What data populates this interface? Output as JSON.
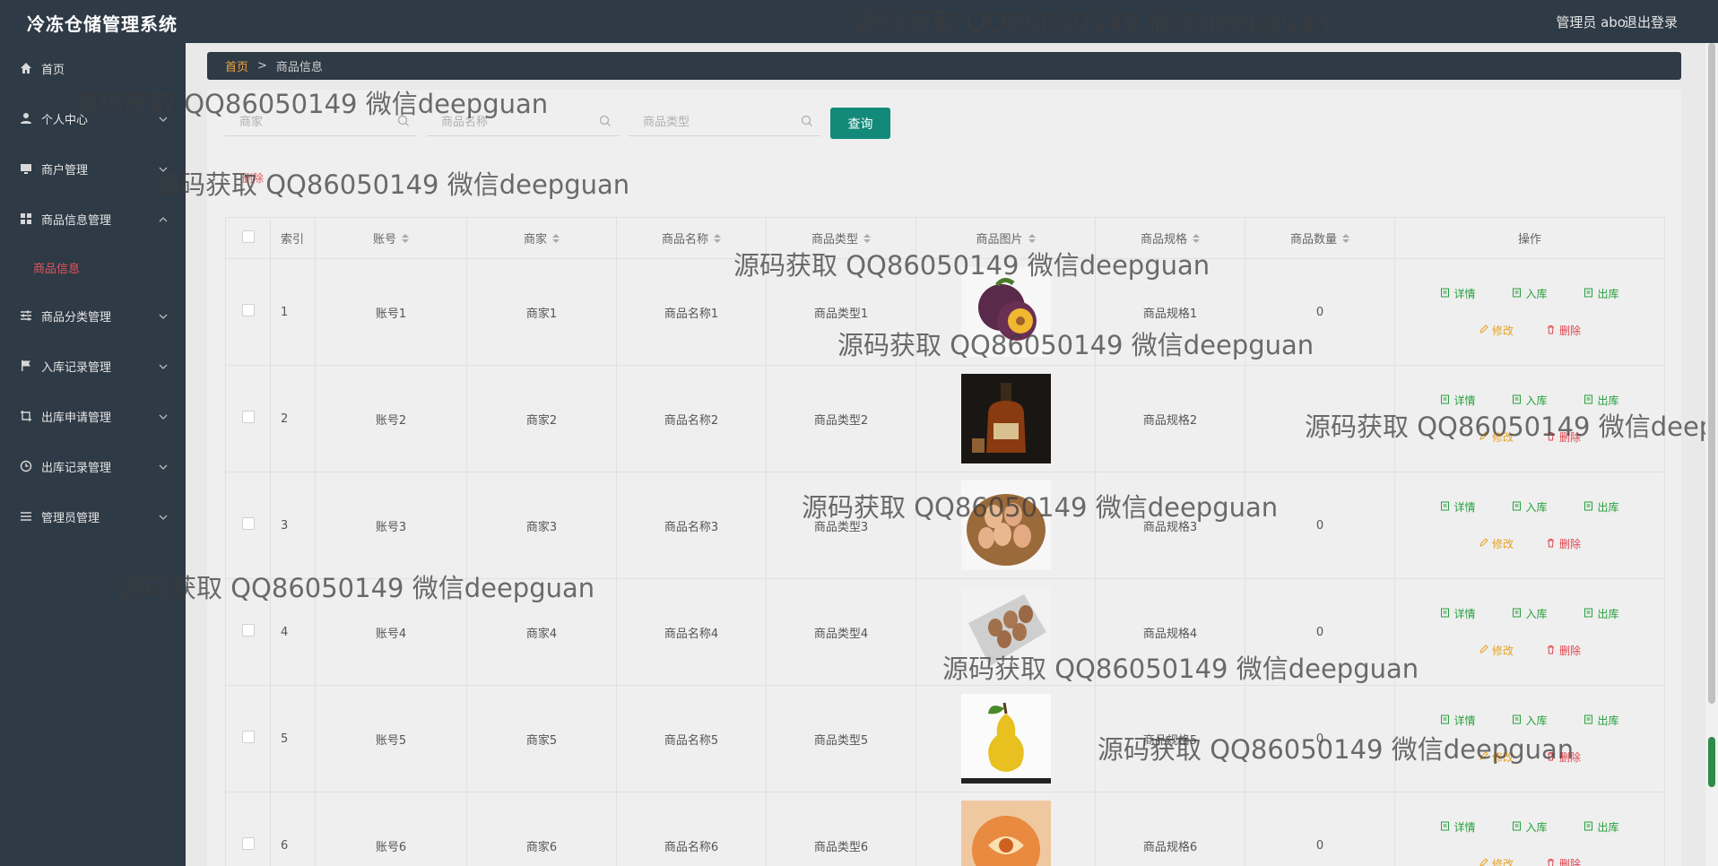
{
  "app": {
    "title": "冷冻仓储管理系统"
  },
  "topbar": {
    "user_label": "管理员 abo",
    "logout_label": "退出登录"
  },
  "sidebar": {
    "items": [
      {
        "label": "首页",
        "icon": "home-icon"
      },
      {
        "label": "个人中心",
        "icon": "user-icon"
      },
      {
        "label": "商户管理",
        "icon": "monitor-icon"
      },
      {
        "label": "商品信息管理",
        "icon": "grid-icon"
      },
      {
        "label": "商品分类管理",
        "icon": "sliders-icon"
      },
      {
        "label": "入库记录管理",
        "icon": "flag-icon"
      },
      {
        "label": "出库申请管理",
        "icon": "crop-icon"
      },
      {
        "label": "出库记录管理",
        "icon": "clock-icon"
      },
      {
        "label": "管理员管理",
        "icon": "list-icon"
      }
    ],
    "active_sub": "商品信息"
  },
  "breadcrumb": {
    "home": "首页",
    "separator": ">",
    "current": "商品信息"
  },
  "search": {
    "merchant_placeholder": "商家",
    "name_placeholder": "商品名称",
    "type_placeholder": "商品类型",
    "query_label": "查询"
  },
  "bulk_delete_label": "删除",
  "table": {
    "headers": {
      "index": "索引",
      "account": "账号",
      "merchant": "商家",
      "name": "商品名称",
      "type": "商品类型",
      "image": "商品图片",
      "spec": "商品规格",
      "qty": "商品数量",
      "ops": "操作"
    },
    "actions": {
      "detail": "详情",
      "in": "入库",
      "out": "出库",
      "edit": "修改",
      "delete": "删除"
    },
    "rows": [
      {
        "index": "1",
        "account": "账号1",
        "merchant": "商家1",
        "name": "商品名称1",
        "type": "商品类型1",
        "spec": "商品规格1",
        "qty": "0",
        "image": "plum"
      },
      {
        "index": "2",
        "account": "账号2",
        "merchant": "商家2",
        "name": "商品名称2",
        "type": "商品类型2",
        "spec": "商品规格2",
        "qty": "",
        "image": "brandy"
      },
      {
        "index": "3",
        "account": "账号3",
        "merchant": "商家3",
        "name": "商品名称3",
        "type": "商品类型3",
        "spec": "商品规格3",
        "qty": "0",
        "image": "eggs-basket"
      },
      {
        "index": "4",
        "account": "账号4",
        "merchant": "商家4",
        "name": "商品名称4",
        "type": "商品类型4",
        "spec": "商品规格4",
        "qty": "0",
        "image": "eggs-tray"
      },
      {
        "index": "5",
        "account": "账号5",
        "merchant": "商家5",
        "name": "商品名称5",
        "type": "商品类型5",
        "spec": "商品规格5",
        "qty": "0",
        "image": "pear"
      },
      {
        "index": "6",
        "account": "账号6",
        "merchant": "商家6",
        "name": "商品名称6",
        "type": "商品类型6",
        "spec": "商品规格6",
        "qty": "0",
        "image": "melon"
      }
    ]
  },
  "watermark": "源码获取 QQ86050149 微信deepguan",
  "colors": {
    "sidebar": "#2e3a46",
    "primary": "#138a79",
    "active": "#e7545b",
    "home": "#f2a33a",
    "green": "#27a03d",
    "orange": "#e6a020",
    "red": "#e0454d"
  }
}
